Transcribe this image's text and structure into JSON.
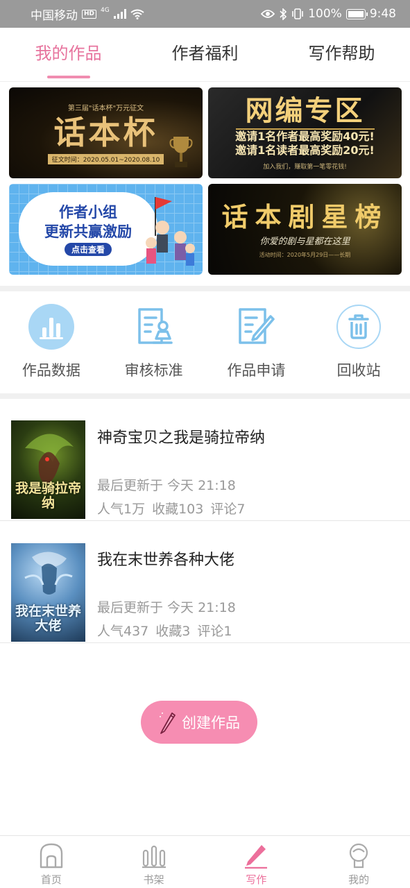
{
  "status_bar": {
    "carrier": "中国移动",
    "hd_badge": "HD",
    "network": "4G",
    "battery": "100%",
    "time": "9:48"
  },
  "tabs": [
    {
      "label": "我的作品",
      "active": true
    },
    {
      "label": "作者福利",
      "active": false
    },
    {
      "label": "写作帮助",
      "active": false
    }
  ],
  "banners": {
    "b1": {
      "small": "第三届\"话本杯\"万元征文",
      "big": "话本杯",
      "date": "征文时间：2020.05.01~2020.08.10"
    },
    "b2": {
      "title": "网编专区",
      "line1": "邀请1名作者最高奖励40元!",
      "line2": "邀请1名读者最高奖励20元!",
      "foot": "加入我们，赚取第一笔零花钱!"
    },
    "b3": {
      "title1": "作者小组",
      "title2": "更新共赢激励",
      "button": "点击查看"
    },
    "b4": {
      "title": "话本剧星榜",
      "sub": "你爱的剧与星都在这里",
      "foot": "活动时间：2020年5月29日——长期"
    }
  },
  "actions": [
    {
      "label": "作品数据",
      "icon": "bar-chart-icon"
    },
    {
      "label": "审核标准",
      "icon": "review-standard-icon"
    },
    {
      "label": "作品申请",
      "icon": "edit-document-icon"
    },
    {
      "label": "回收站",
      "icon": "trash-icon"
    }
  ],
  "works": [
    {
      "title": "神奇宝贝之我是骑拉帝纳",
      "cover_text": "我是骑拉帝纳",
      "updated": "最后更新于 今天 21:18",
      "popularity": "人气1万",
      "favorites": "收藏103",
      "comments": "评论7"
    },
    {
      "title": "我在末世养各种大佬",
      "cover_text": "我在末世养大佬",
      "updated": "最后更新于 今天 21:18",
      "popularity": "人气437",
      "favorites": "收藏3",
      "comments": "评论1"
    }
  ],
  "create_button": {
    "label": "创建作品"
  },
  "bottom_nav": [
    {
      "label": "首页",
      "icon": "home-icon",
      "active": false
    },
    {
      "label": "书架",
      "icon": "bookshelf-icon",
      "active": false
    },
    {
      "label": "写作",
      "icon": "pen-icon",
      "active": true
    },
    {
      "label": "我的",
      "icon": "profile-icon",
      "active": false
    }
  ],
  "colors": {
    "accent": "#e7739d",
    "create_button": "#f68db2",
    "icon_blue": "#7cc0ea"
  }
}
